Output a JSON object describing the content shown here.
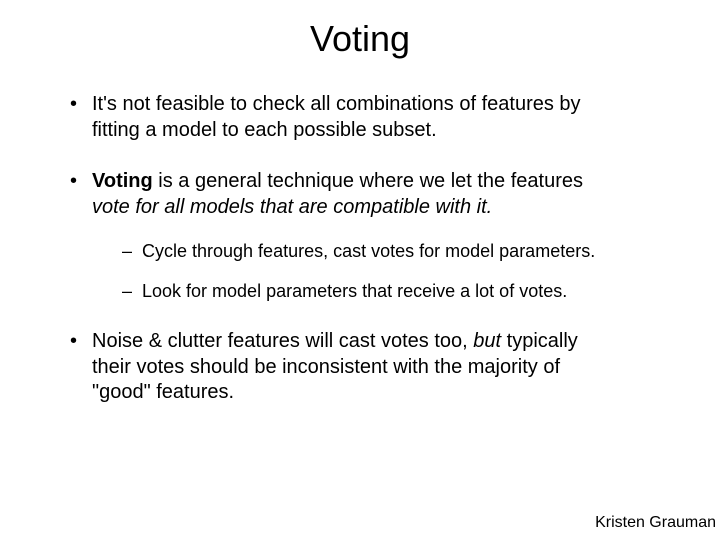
{
  "title": "Voting",
  "bullets": {
    "b1a": "It's not feasible to check all combinations of features by",
    "b1b": "fitting a model to each possible subset.",
    "b2_bold": "Voting",
    "b2a": " is a general technique where we let the features",
    "b2_italic": "vote for all models that are compatible with it.",
    "s1": "Cycle through features, cast votes for model parameters.",
    "s2": "Look for model parameters that receive a lot of votes.",
    "b3a": "Noise & clutter features will cast votes too, ",
    "b3_but": "but",
    "b3b": " typically",
    "b3c": "their votes should be inconsistent with the majority of",
    "b3d": "\"good\" features."
  },
  "credit": "Kristen Grauman"
}
